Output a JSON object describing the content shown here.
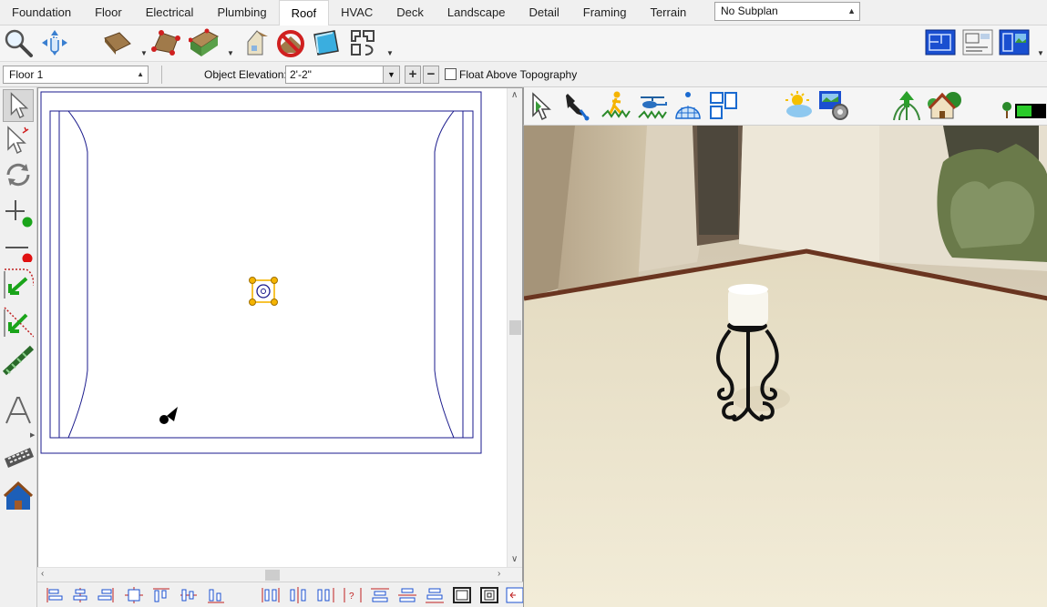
{
  "tabs": [
    {
      "label": "Foundation",
      "active": false
    },
    {
      "label": "Floor",
      "active": false
    },
    {
      "label": "Electrical",
      "active": false
    },
    {
      "label": "Plumbing",
      "active": false
    },
    {
      "label": "Roof",
      "active": true
    },
    {
      "label": "HVAC",
      "active": false
    },
    {
      "label": "Deck",
      "active": false
    },
    {
      "label": "Landscape",
      "active": false
    },
    {
      "label": "Detail",
      "active": false
    },
    {
      "label": "Framing",
      "active": false
    },
    {
      "label": "Terrain",
      "active": false
    }
  ],
  "subplan": {
    "value": "No Subplan"
  },
  "toolbar2": {
    "floor_value": "Floor 1",
    "elevation_label": "Object Elevation:",
    "elevation_value": "2'-2\"",
    "plus_label": "+",
    "minus_label": "−",
    "float_label": "Float Above Topography",
    "float_checked": false
  },
  "icons": {
    "main_toolbar": [
      "zoom-icon",
      "pan-icon",
      "roof-plane-icon",
      "roof-baseline-icon",
      "auto-roof-icon",
      "gable-wall-icon",
      "no-roof-icon",
      "skylight-icon",
      "roof-tools-icon"
    ],
    "view_buttons": [
      "floor-plan-view-icon",
      "layout-view-icon",
      "camera-view-icon"
    ],
    "left_toolbar": [
      "select-objects-icon",
      "select-edit-icon",
      "rotate-icon",
      "add-point-icon",
      "delete-point-icon",
      "break-line-icon",
      "align-icon",
      "roof-trim-icon",
      "text-icon",
      "walkthrough-icon",
      "house-icon"
    ],
    "view_3d_toolbar": [
      "select-3d-icon",
      "material-eyedropper-icon",
      "walkthrough-camera-icon",
      "drone-camera-icon",
      "orbit-icon",
      "plan-footprint-icon",
      "sun-angle-icon",
      "camera-settings-icon",
      "plant-growth-icon",
      "house-landscape-icon",
      "terrain-toggle-icon"
    ],
    "bottom_toolbar": [
      "align-left-icon",
      "align-center-icon",
      "align-right-icon",
      "center-object-icon",
      "align-top-icon",
      "align-middle-icon",
      "align-bottom-icon",
      "distribute-h-icon",
      "distribute-v-icon",
      "distribute-gap-icon",
      "space-evenly-icon",
      "align-top-edge-icon",
      "align-center-edge-icon",
      "align-bottom-edge-icon",
      "frame-icon",
      "frame-nested-icon",
      "frame-edge-icon"
    ]
  },
  "colors": {
    "plan_line": "#1a1a8c",
    "selection_handle": "#f5b400",
    "floor_3d": "#e9e0c4",
    "wall_3d": "#ece6d6"
  }
}
